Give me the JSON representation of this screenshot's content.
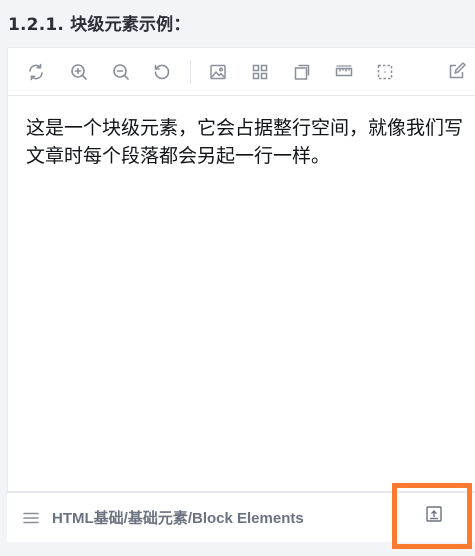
{
  "section": {
    "title": "1.2.1.  块级元素示例："
  },
  "toolbar": {
    "icons": [
      "refresh-icon",
      "zoom-in-icon",
      "zoom-out-icon",
      "reset-icon",
      "image-icon",
      "grid-icon",
      "layers-icon",
      "ruler-icon",
      "select-icon",
      "edit-icon"
    ]
  },
  "content": {
    "text": "这是一个块级元素，它会占据整行空间，就像我们写文章时每个段落都会另起一行一样。"
  },
  "footer": {
    "breadcrumb": "HTML基础/基础元素/Block Elements"
  },
  "colors": {
    "highlight": "#ff7a2f",
    "icon": "#8a9099",
    "background": "#f3f4f8"
  }
}
